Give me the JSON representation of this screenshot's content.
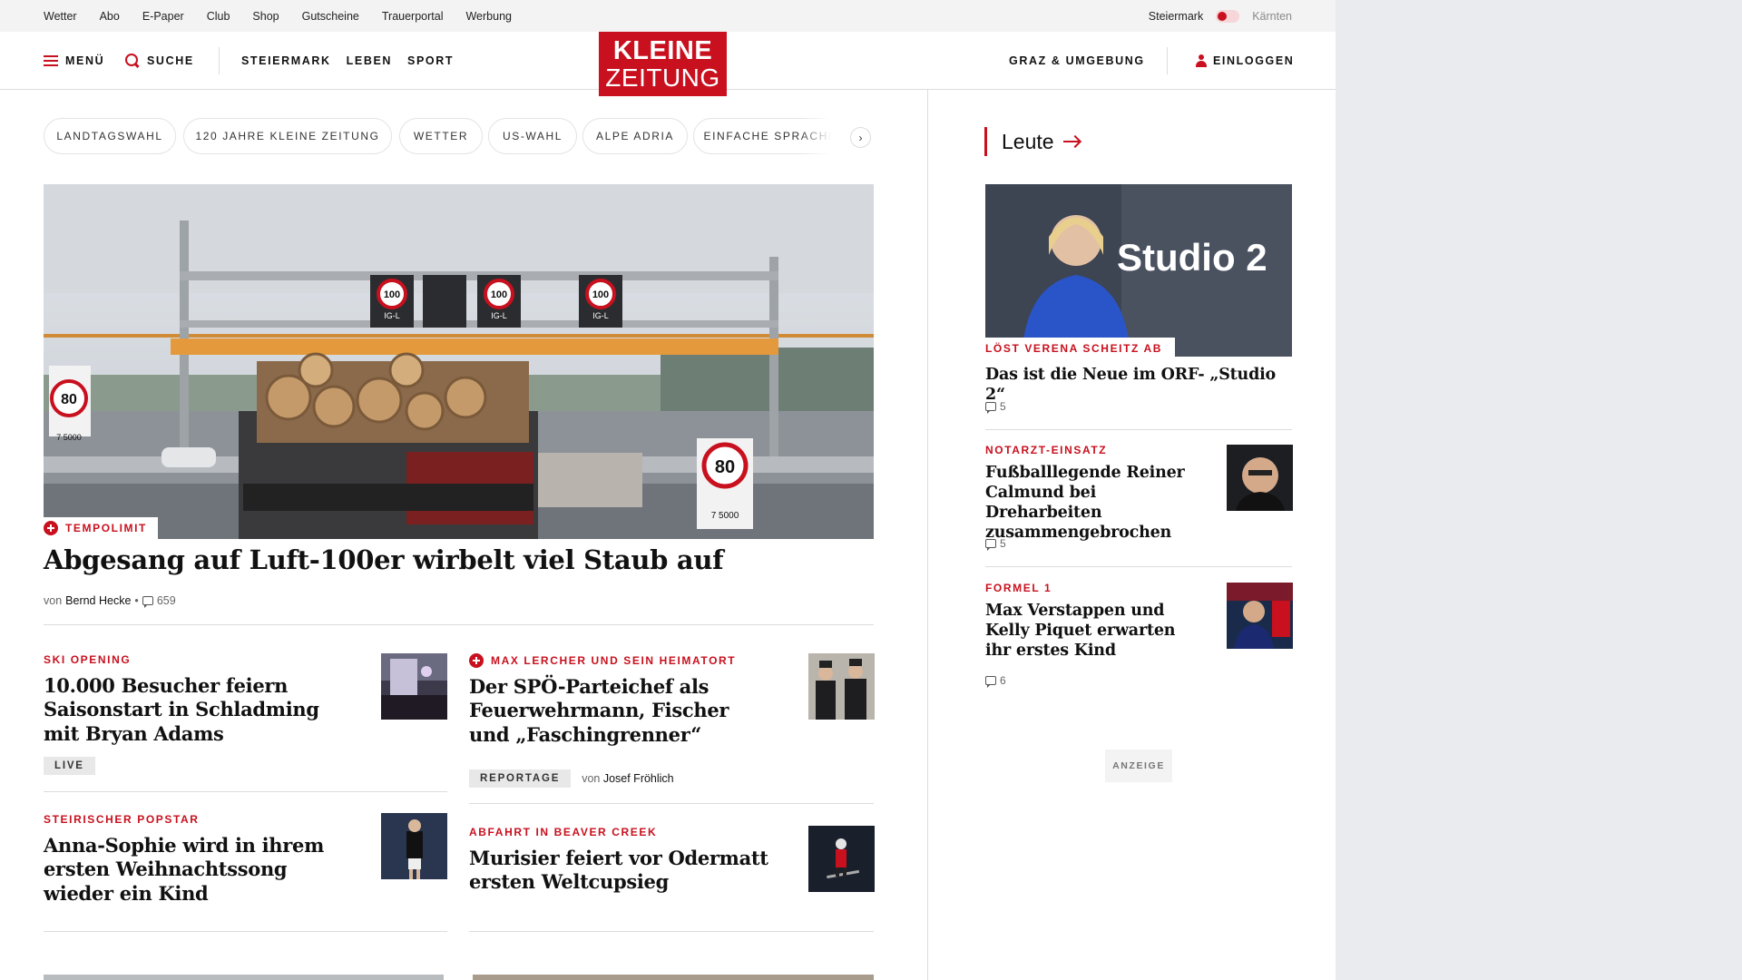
{
  "topbar": {
    "links": [
      "Wetter",
      "Abo",
      "E-Paper",
      "Club",
      "Shop",
      "Gutscheine",
      "Trauerportal",
      "Werbung"
    ],
    "region_active": "Steiermark",
    "region_inactive": "Kärnten"
  },
  "header": {
    "menu_label": "MENÜ",
    "search_label": "SUCHE",
    "nav": [
      "STEIERMARK",
      "LEBEN",
      "SPORT"
    ],
    "logo_line1": "KLEINE",
    "logo_line2": "ZEITUNG",
    "region_link": "GRAZ & UMGEBUNG",
    "login_label": "EINLOGGEN"
  },
  "chips": [
    "LANDTAGSWAHL",
    "120 JAHRE KLEINE ZEITUNG",
    "WETTER",
    "US-WAHL",
    "ALPE ADRIA",
    "EINFACHE SPRACHE"
  ],
  "hero": {
    "kicker": "TEMPOLIMIT",
    "title": "Abgesang auf Luft-100er wirbelt viel Staub auf",
    "by": "von",
    "author": "Bernd Hecke",
    "sep": "•",
    "comments": "659",
    "signs": [
      "100",
      "100",
      "100",
      "80",
      "80"
    ],
    "sign_sub": [
      "IG-L",
      "IG-L",
      "IG-L"
    ],
    "weight_sub": [
      "7 5000",
      "7 5000"
    ]
  },
  "articles": [
    {
      "kicker": "SKI OPENING",
      "title": "10.000 Besucher feiern Saisonstart in Schladming mit Bryan Adams",
      "badge": "LIVE"
    },
    {
      "kicker": "MAX LERCHER UND SEIN HEIMATORT",
      "title": "Der SPÖ-Parteichef als Feuerwehrmann, Fischer und „Faschingrenner“",
      "badge": "REPORTAGE",
      "by": "von",
      "author": "Josef Fröhlich"
    },
    {
      "kicker": "STEIRISCHER POPSTAR",
      "title": "Anna-Sophie wird in ihrem ersten Weihnachtssong wieder ein Kind"
    },
    {
      "kicker": "ABFAHRT IN BEAVER CREEK",
      "title": "Murisier feiert vor Odermatt ersten Weltcupsieg"
    }
  ],
  "sidebar": {
    "section_title": "Leute",
    "studio_logo": "Studio 2",
    "items": [
      {
        "kicker": "LÖST VERENA SCHEITZ AB",
        "title": "Das ist die Neue im ORF- „Studio 2“",
        "comments": "5"
      },
      {
        "kicker": "NOTARZT-EINSATZ",
        "title": "Fußballlegende Reiner Calmund bei Dreharbeiten zusammengebrochen",
        "comments": "5"
      },
      {
        "kicker": "FORMEL 1",
        "title": "Max Verstappen und Kelly Piquet erwarten ihr erstes Kind",
        "comments": "6"
      }
    ],
    "ad_label": "ANZEIGE"
  },
  "colors": {
    "brand_red": "#c8101e",
    "divider": "#dcdcdc"
  }
}
